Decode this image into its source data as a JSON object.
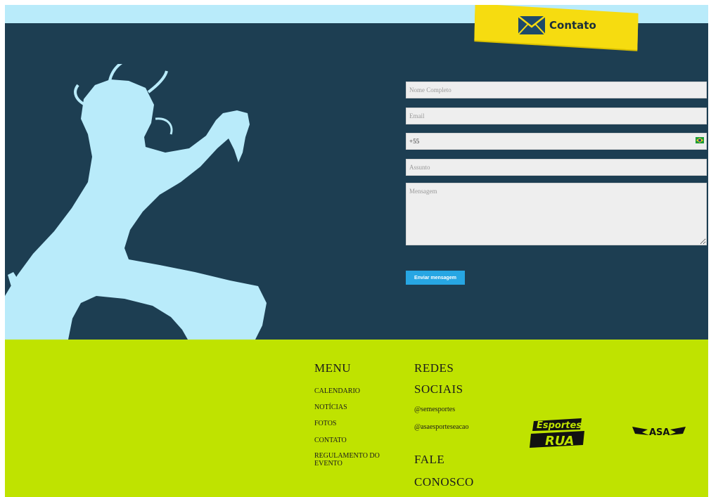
{
  "header": {
    "tab_label": "Contato",
    "tab_icon": "envelope-icon"
  },
  "form": {
    "name_placeholder": "Nome Completo",
    "email_placeholder": "Email",
    "phone_value": "+55",
    "subject_placeholder": "Assunto",
    "message_placeholder": "Mensagem",
    "submit_label": "Enviar mensagem"
  },
  "footer": {
    "menu_title": "MENU",
    "menu_items": [
      "CALENDARIO",
      "NOTÍCIAS",
      "FOTOS",
      "CONTATO",
      "REGULAMENTO DO EVENTO"
    ],
    "social_title_1": "REDES",
    "social_title_2": "SOCIAIS",
    "social_links": [
      "@semesportes",
      "@asaesporteseacao"
    ],
    "contact_title_1": "FALE",
    "contact_title_2": "CONOSCO",
    "logos": [
      "Esportes na RUA",
      "ASA"
    ]
  },
  "colors": {
    "hero_bg": "#1d3e52",
    "silhouette": "#b9ebfa",
    "tab_yellow": "#f6dc10",
    "footer_bg": "#bfe300",
    "button": "#27a6e3"
  }
}
